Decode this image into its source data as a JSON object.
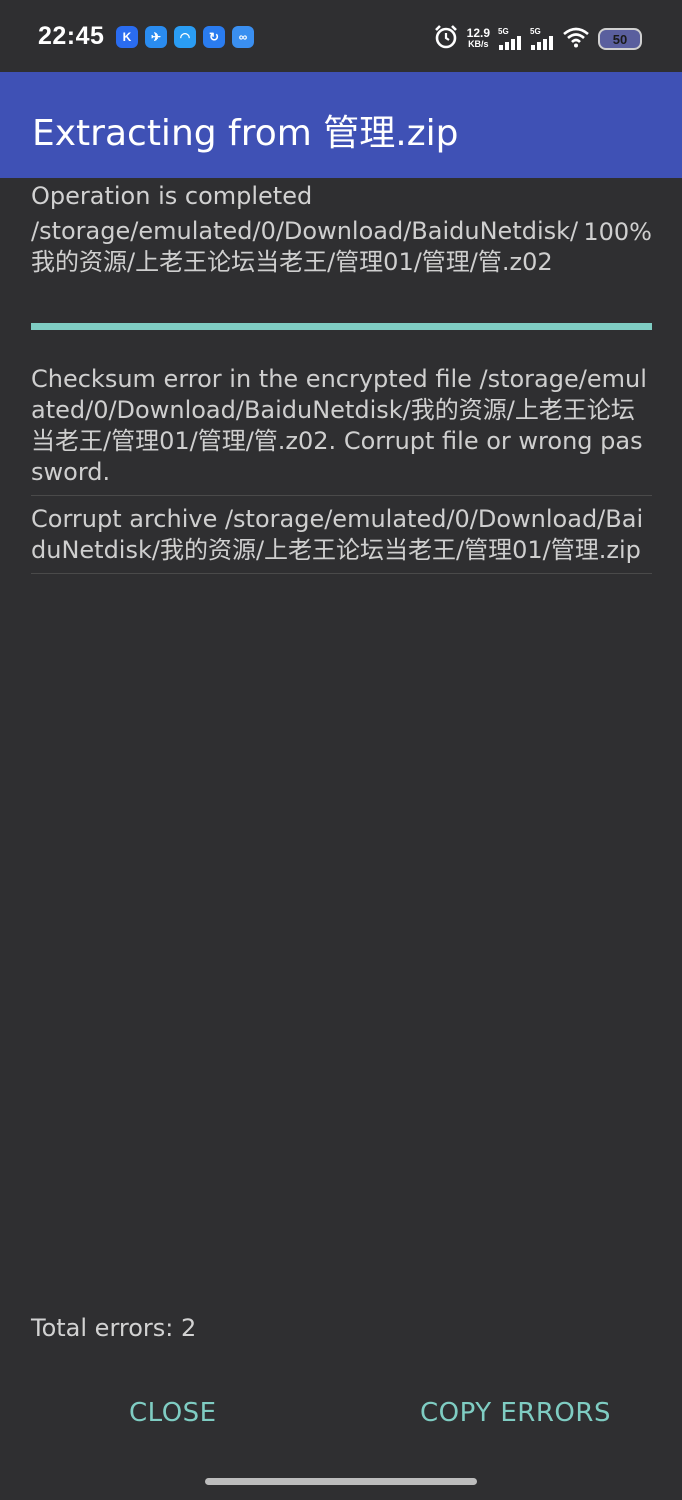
{
  "status_bar": {
    "time": "22:45",
    "notification_icons": [
      {
        "icon": "k-app-icon",
        "glyph": "K",
        "color": "#2a6cf0"
      },
      {
        "icon": "bird-app-icon",
        "glyph": "✈",
        "color": "#2a8cf0"
      },
      {
        "icon": "cloud-app-icon",
        "glyph": "◠",
        "color": "#2a9df4"
      },
      {
        "icon": "refresh-app-icon",
        "glyph": "↻",
        "color": "#2a7cf0"
      },
      {
        "icon": "netdisk-app-icon",
        "glyph": "∞",
        "color": "#3a8ff0"
      }
    ],
    "net_speed_value": "12.9",
    "net_speed_unit": "KB/s",
    "signal1_label": "5G",
    "signal2_label": "5G",
    "battery": "50"
  },
  "app_bar": {
    "title": "Extracting from 管理.zip"
  },
  "operation": {
    "status": "Operation is completed",
    "path": "/storage/emulated/0/Download/BaiduNetdisk/我的资源/上老王论坛当老王/管理01/管理/管.z02",
    "percent_label": "100%",
    "progress": 1.0
  },
  "errors": [
    "Checksum error in the encrypted file /storage/emulated/0/Download/BaiduNetdisk/我的资源/上老王论坛当老王/管理01/管理/管.z02. Corrupt file or wrong password.",
    "Corrupt archive /storage/emulated/0/Download/BaiduNetdisk/我的资源/上老王论坛当老王/管理01/管理.zip"
  ],
  "footer": {
    "total_errors": "Total errors: 2",
    "close_label": "CLOSE",
    "copy_errors_label": "COPY ERRORS"
  },
  "colors": {
    "app_bar": "#3f51b5",
    "accent": "#7fcdc3",
    "background": "#2f2f31"
  }
}
